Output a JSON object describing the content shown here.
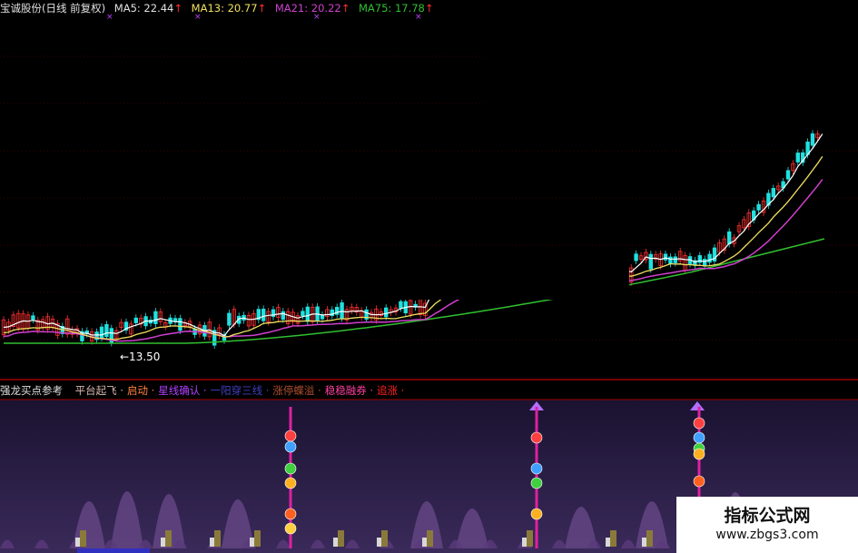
{
  "header": {
    "stock_title": "宝诚股份(日线 前复权)",
    "ma5": "MA5: 22.44",
    "ma13": "MA13: 20.77",
    "ma21": "MA21: 20.22",
    "ma75": "MA75: 17.78",
    "up_arrow": "↑",
    "marker": "×"
  },
  "price_chart": {
    "low_label": "←13.50",
    "colors": {
      "ma5": "#ffffff",
      "ma13": "#f0e060",
      "ma21": "#d040d0",
      "ma75": "#30c030",
      "up": "#ff3030",
      "down": "#20e0e0",
      "grid": "#7a0000"
    }
  },
  "indicator_panel": {
    "title": "强龙买点参考",
    "legend": [
      {
        "label": "平台起飞",
        "color": "#d8b8b0"
      },
      {
        "label": "启动",
        "color": "#ff8040"
      },
      {
        "label": "星线确认",
        "color": "#b040ff"
      },
      {
        "label": "一阳穿三线",
        "color": "#4040c0"
      },
      {
        "label": "涨停蝶溢",
        "color": "#b05030"
      },
      {
        "label": "稳稳融券",
        "color": "#ff40a0"
      },
      {
        "label": "追涨",
        "color": "#ff2020"
      }
    ],
    "separator": "·"
  },
  "badge": {
    "title": "指标公式网",
    "url": "www.zbgs3.com"
  }
}
